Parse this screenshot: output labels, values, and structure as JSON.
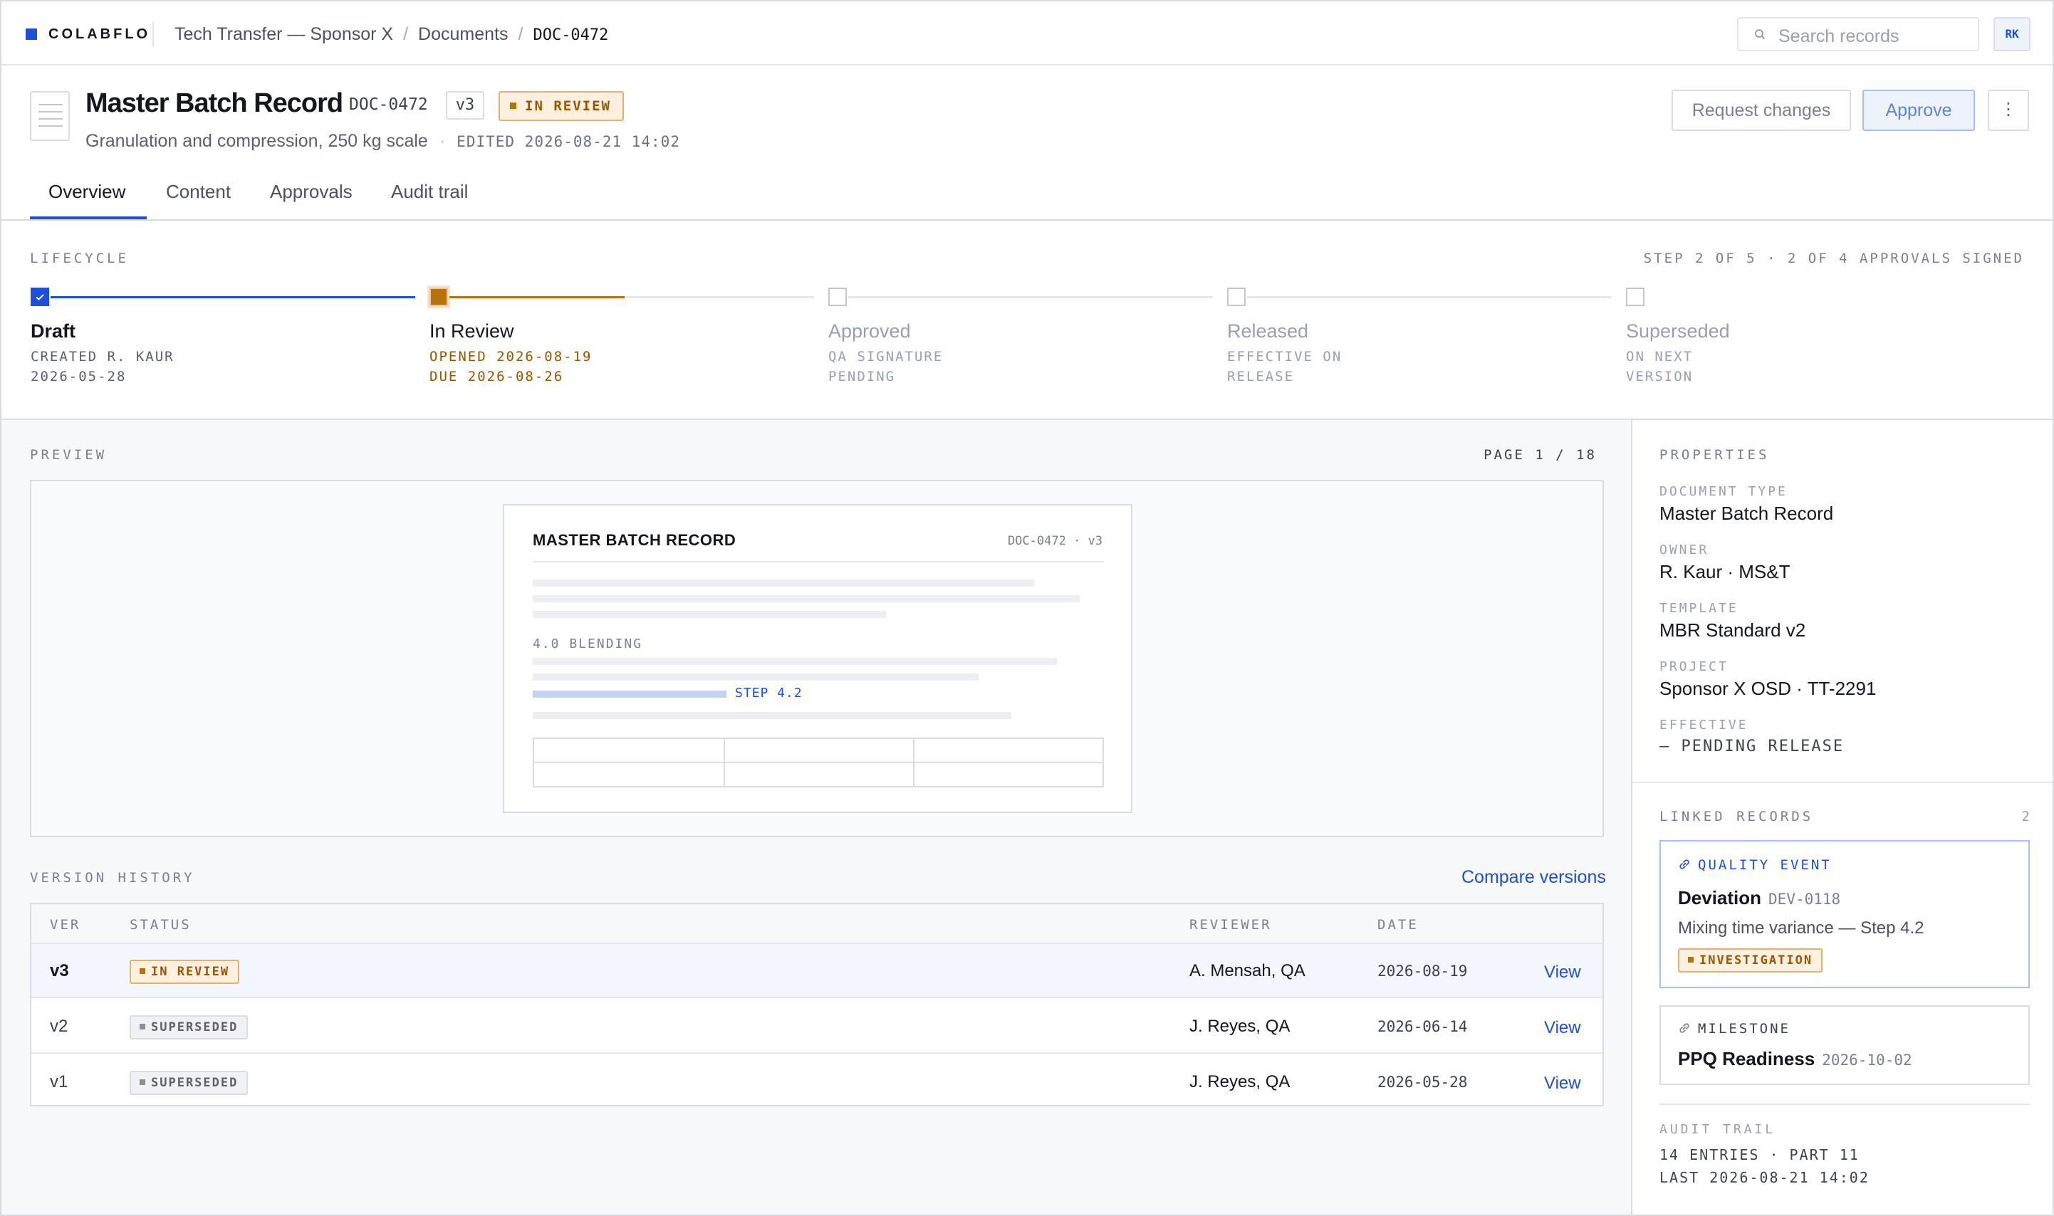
{
  "app": {
    "logo_text": "COLABFLO",
    "brand_color": "#1f4fd8"
  },
  "breadcrumb": {
    "items": [
      "Tech Transfer — Sponsor X",
      "Documents"
    ],
    "current": "DOC-0472",
    "separator": "/"
  },
  "search": {
    "placeholder": "Search records"
  },
  "user": {
    "initials": "RK"
  },
  "document": {
    "title": "Master Batch Record",
    "id": "DOC-0472",
    "version": "v3",
    "status": "IN REVIEW",
    "subtitle": "Granulation and compression, 250 kg scale",
    "edited": "EDITED 2026-08-21 14:02"
  },
  "actions": {
    "request_changes": "Request changes",
    "approve": "Approve",
    "more": "⋮"
  },
  "tabs": [
    {
      "label": "Overview",
      "active": true
    },
    {
      "label": "Content",
      "active": false
    },
    {
      "label": "Approvals",
      "active": false
    },
    {
      "label": "Audit trail",
      "active": false
    }
  ],
  "lifecycle": {
    "label": "LIFECYCLE",
    "meta": "STEP 2 OF 5 · 2 OF 4 APPROVALS SIGNED",
    "steps": [
      {
        "name": "Draft",
        "line1": "CREATED R. KAUR",
        "line2": "2026-05-28",
        "state": "done",
        "progress": 1.0
      },
      {
        "name": "In Review",
        "line1": "OPENED 2026-08-19",
        "line2": "DUE 2026-08-26",
        "state": "current",
        "progress": 0.48
      },
      {
        "name": "Approved",
        "line1": "QA SIGNATURE",
        "line2": "PENDING",
        "state": "pending",
        "progress": 0
      },
      {
        "name": "Released",
        "line1": "EFFECTIVE ON",
        "line2": "RELEASE",
        "state": "pending",
        "progress": 0
      },
      {
        "name": "Superseded",
        "line1": "ON NEXT",
        "line2": "VERSION",
        "state": "pending",
        "progress": 0
      }
    ],
    "colors": {
      "done": "#1f4fd8",
      "current": "#b8710f",
      "current_text": "#9a5500",
      "pending_text": "#9aa0a9"
    }
  },
  "preview": {
    "label": "PREVIEW",
    "page": "PAGE 1 / 18",
    "paper_title": "MASTER BATCH RECORD",
    "paper_id": "DOC-0472 · v3",
    "section": "4.0 BLENDING",
    "step_ref": "STEP 4.2"
  },
  "version_history": {
    "label": "VERSION HISTORY",
    "compare": "Compare versions",
    "columns": [
      "VER",
      "STATUS",
      "REVIEWER",
      "DATE"
    ],
    "rows": [
      {
        "ver": "v3",
        "status": "IN REVIEW",
        "reviewer": "A. Mensah, QA",
        "date": "2026-08-19",
        "action": "View"
      },
      {
        "ver": "v2",
        "status": "SUPERSEDED",
        "reviewer": "J. Reyes, QA",
        "date": "2026-06-14",
        "action": "View"
      },
      {
        "ver": "v1",
        "status": "SUPERSEDED",
        "reviewer": "J. Reyes, QA",
        "date": "2026-05-28",
        "action": "View"
      }
    ]
  },
  "properties": {
    "label": "PROPERTIES",
    "items": [
      {
        "label": "DOCUMENT TYPE",
        "value": "Master Batch Record"
      },
      {
        "label": "OWNER",
        "value": "R. Kaur · MS&T"
      },
      {
        "label": "TEMPLATE",
        "value": "MBR Standard v2"
      },
      {
        "label": "PROJECT",
        "value": "Sponsor X OSD · TT-2291"
      },
      {
        "label": "EFFECTIVE",
        "value": "— PENDING RELEASE"
      }
    ]
  },
  "linked": {
    "label": "LINKED RECORDS",
    "count": "2",
    "records": [
      {
        "kind": "QUALITY EVENT",
        "title": "Deviation",
        "id": "DEV-0118",
        "desc": "Mixing time variance — Step 4.2",
        "badge": "INVESTIGATION"
      },
      {
        "kind": "MILESTONE",
        "title": "PPQ Readiness",
        "id": "2026-10-02"
      }
    ]
  },
  "audit": {
    "label": "AUDIT TRAIL",
    "line1": "14 ENTRIES · PART 11",
    "line2": "LAST 2026-08-21 14:02"
  }
}
